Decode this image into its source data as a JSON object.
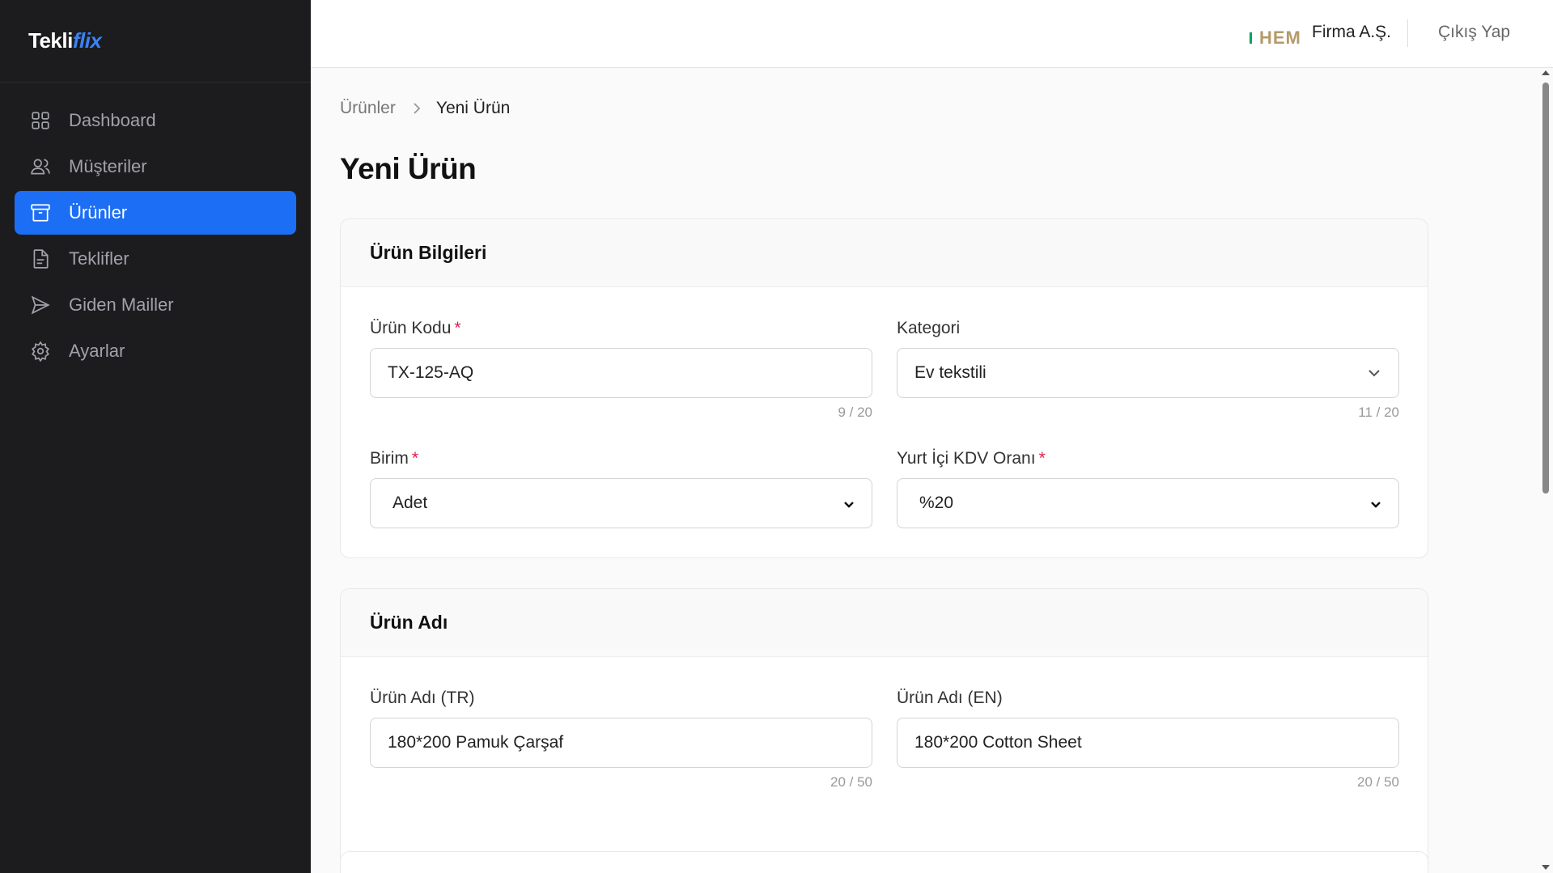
{
  "brand": {
    "prefix": "Tekli",
    "accent": "flix"
  },
  "sidebar": {
    "items": [
      {
        "label": "Dashboard",
        "icon": "grid-icon"
      },
      {
        "label": "Müşteriler",
        "icon": "users-icon"
      },
      {
        "label": "Ürünler",
        "icon": "archive-box-icon",
        "active": true
      },
      {
        "label": "Teklifler",
        "icon": "document-icon"
      },
      {
        "label": "Giden Mailler",
        "icon": "send-icon"
      },
      {
        "label": "Ayarlar",
        "icon": "gear-icon"
      }
    ]
  },
  "header": {
    "logo_text": "HEM",
    "company": "Firma A.Ş.",
    "logout": "Çıkış Yap"
  },
  "breadcrumb": {
    "parent": "Ürünler",
    "current": "Yeni Ürün"
  },
  "page_title": "Yeni Ürün",
  "product_info": {
    "title": "Ürün Bilgileri",
    "code": {
      "label": "Ürün Kodu",
      "value": "TX-125-AQ",
      "counter": "9 / 20"
    },
    "category": {
      "label": "Kategori",
      "value": "Ev tekstili",
      "counter": "11 / 20"
    },
    "unit": {
      "label": "Birim",
      "value": "Adet"
    },
    "vat": {
      "label": "Yurt İçi KDV Oranı",
      "value": "%20"
    }
  },
  "product_name": {
    "title": "Ürün Adı",
    "tr": {
      "label": "Ürün Adı (TR)",
      "value": "180*200 Pamuk Çarşaf",
      "counter": "20 / 50"
    },
    "en": {
      "label": "Ürün Adı (EN)",
      "value": "180*200 Cotton Sheet",
      "counter": "20 / 50"
    }
  },
  "colors": {
    "accent": "#1c6ef5",
    "sidebar_bg": "#1c1c1e",
    "required": "#e11d48"
  }
}
